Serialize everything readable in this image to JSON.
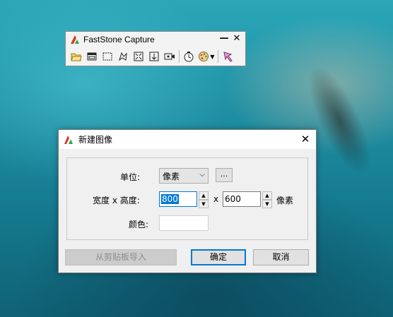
{
  "toolbar": {
    "title": "FastStone Capture",
    "minimize_glyph": "—",
    "close_glyph": "✕",
    "tools": [
      "open-folder-icon",
      "capture-window-icon",
      "capture-rectangle-icon",
      "capture-freehand-icon",
      "capture-fullscreen-icon",
      "capture-scrolling-icon",
      "screen-recorder-icon",
      "delay-timer-icon",
      "output-palette-icon",
      "settings-icon"
    ]
  },
  "dialog": {
    "title": "新建图像",
    "close_glyph": "✕",
    "unit_label": "单位:",
    "unit_value": "像素",
    "dots_label": "...",
    "size_label": "宽度 x 高度:",
    "width_value": "800",
    "x_label": "x",
    "height_value": "600",
    "size_unit": "像素",
    "color_label": "颜色:",
    "paste_button": "从剪贴板导入",
    "ok_button": "确定",
    "cancel_button": "取消"
  },
  "colors": {
    "accent": "#0078d7",
    "dialog_bg": "#f0f0f0",
    "water": "#1f8fa3"
  }
}
